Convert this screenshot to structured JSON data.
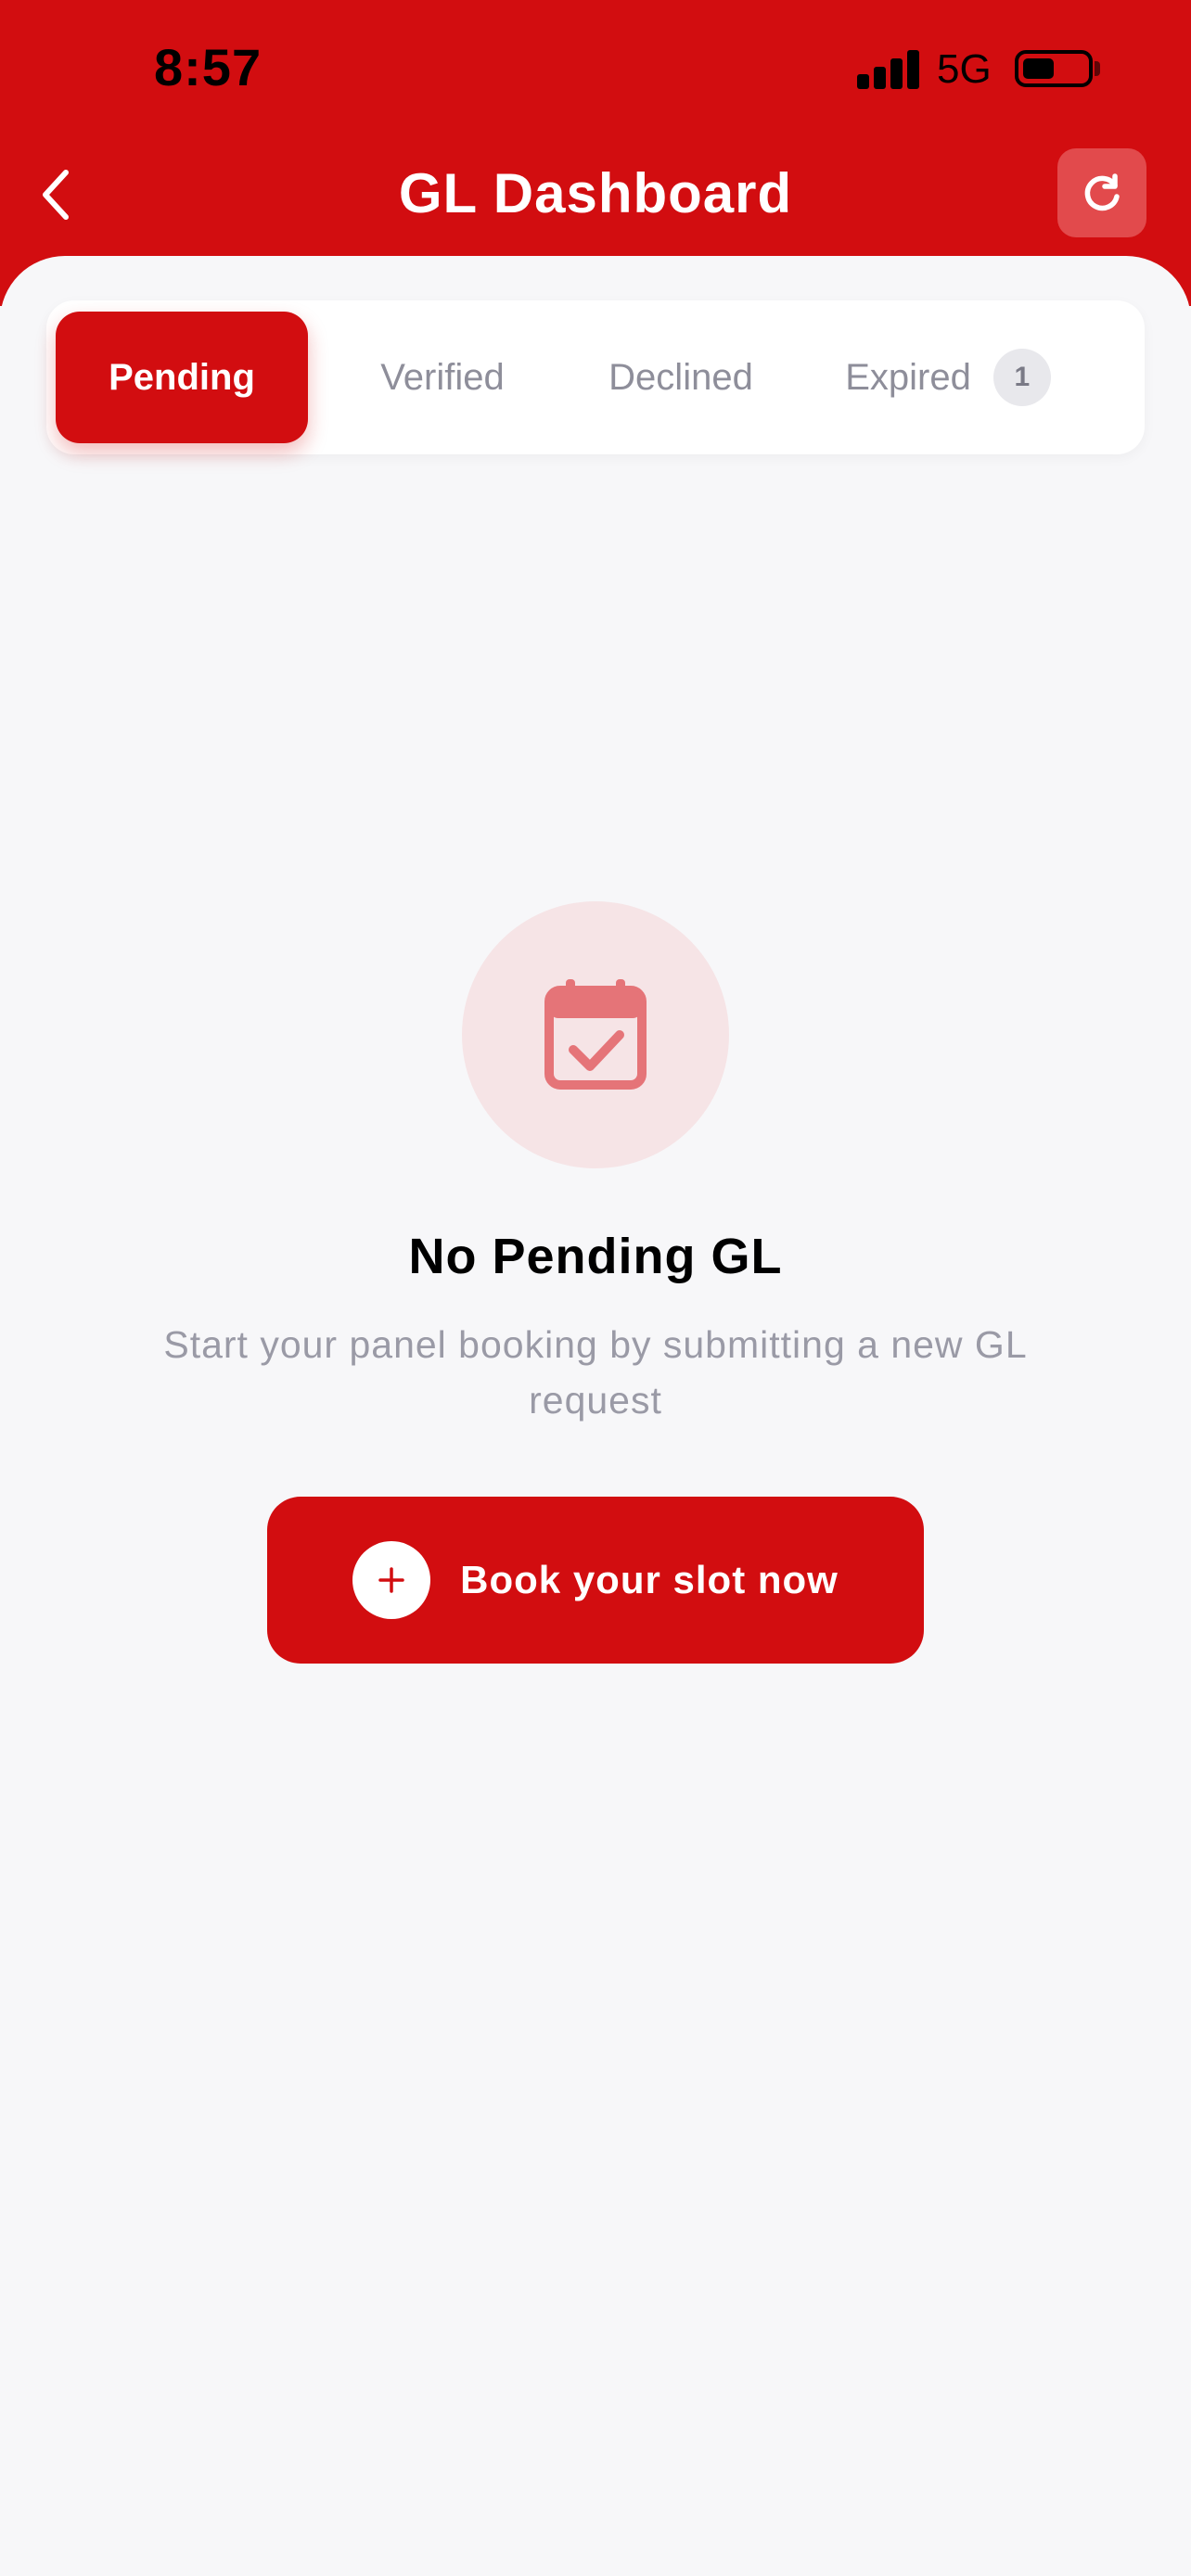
{
  "status_bar": {
    "time": "8:57",
    "network": "5G",
    "battery_level": 0.5
  },
  "header": {
    "title": "GL Dashboard",
    "back_icon": "chevron-left-icon",
    "refresh_icon": "refresh-icon"
  },
  "tabs": [
    {
      "label": "Pending",
      "active": true
    },
    {
      "label": "Verified",
      "active": false
    },
    {
      "label": "Declined",
      "active": false
    },
    {
      "label": "Expired",
      "active": false,
      "badge": "1"
    }
  ],
  "empty_state": {
    "icon": "calendar-check-icon",
    "title": "No Pending GL",
    "subtitle": "Start your panel booking by submitting a new GL request"
  },
  "cta": {
    "label": "Book your slot now",
    "icon": "plus-icon"
  },
  "colors": {
    "brand_red": "#D20D10",
    "background": "#F7F7F9",
    "muted_text": "#9A9AA6",
    "tab_inactive_text": "#8E8E9A"
  }
}
